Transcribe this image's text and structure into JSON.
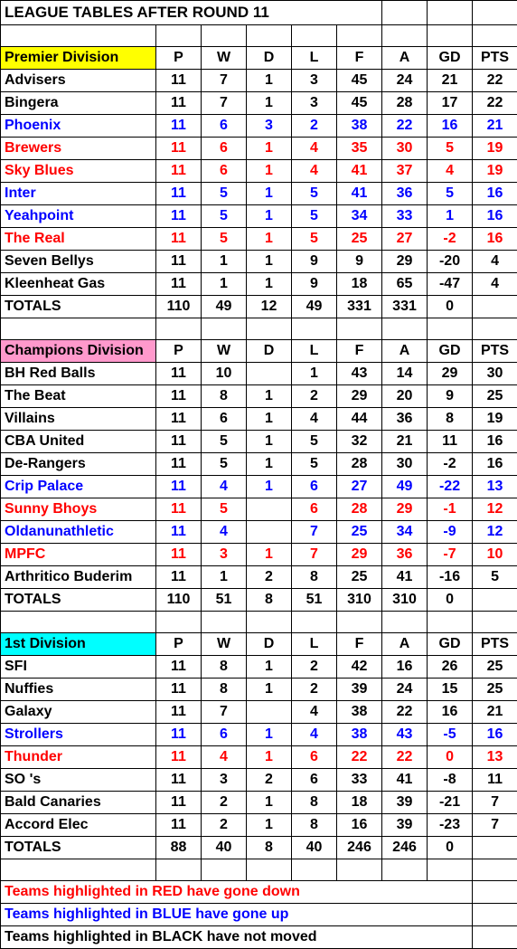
{
  "title": "LEAGUE TABLES AFTER ROUND 11",
  "columns": [
    "P",
    "W",
    "D",
    "L",
    "F",
    "A",
    "GD",
    "PTS"
  ],
  "divisions": [
    {
      "name": "Premier Division",
      "bg": "yellow",
      "rows": [
        {
          "team": "Advisers",
          "color": "c-black",
          "v": [
            "11",
            "7",
            "1",
            "3",
            "45",
            "24",
            "21",
            "22"
          ]
        },
        {
          "team": "Bingera",
          "color": "c-black",
          "v": [
            "11",
            "7",
            "1",
            "3",
            "45",
            "28",
            "17",
            "22"
          ]
        },
        {
          "team": "Phoenix",
          "color": "c-blue",
          "v": [
            "11",
            "6",
            "3",
            "2",
            "38",
            "22",
            "16",
            "21"
          ]
        },
        {
          "team": "Brewers",
          "color": "c-red",
          "v": [
            "11",
            "6",
            "1",
            "4",
            "35",
            "30",
            "5",
            "19"
          ]
        },
        {
          "team": "Sky Blues",
          "color": "c-red",
          "v": [
            "11",
            "6",
            "1",
            "4",
            "41",
            "37",
            "4",
            "19"
          ]
        },
        {
          "team": "Inter",
          "color": "c-blue",
          "v": [
            "11",
            "5",
            "1",
            "5",
            "41",
            "36",
            "5",
            "16"
          ]
        },
        {
          "team": "Yeahpoint",
          "color": "c-blue",
          "v": [
            "11",
            "5",
            "1",
            "5",
            "34",
            "33",
            "1",
            "16"
          ]
        },
        {
          "team": "The Real",
          "color": "c-red",
          "v": [
            "11",
            "5",
            "1",
            "5",
            "25",
            "27",
            "-2",
            "16"
          ]
        },
        {
          "team": "Seven Bellys",
          "color": "c-black",
          "v": [
            "11",
            "1",
            "1",
            "9",
            "9",
            "29",
            "-20",
            "4"
          ]
        },
        {
          "team": "Kleenheat Gas",
          "color": "c-black",
          "v": [
            "11",
            "1",
            "1",
            "9",
            "18",
            "65",
            "-47",
            "4"
          ]
        }
      ],
      "totals": [
        "110",
        "49",
        "12",
        "49",
        "331",
        "331",
        "0",
        ""
      ]
    },
    {
      "name": "Champions Division",
      "bg": "pink",
      "rows": [
        {
          "team": "BH Red Balls",
          "color": "c-black",
          "v": [
            "11",
            "10",
            "",
            "1",
            "43",
            "14",
            "29",
            "30"
          ]
        },
        {
          "team": "The Beat",
          "color": "c-black",
          "v": [
            "11",
            "8",
            "1",
            "2",
            "29",
            "20",
            "9",
            "25"
          ]
        },
        {
          "team": "Villains",
          "color": "c-black",
          "v": [
            "11",
            "6",
            "1",
            "4",
            "44",
            "36",
            "8",
            "19"
          ]
        },
        {
          "team": "CBA United",
          "color": "c-black",
          "v": [
            "11",
            "5",
            "1",
            "5",
            "32",
            "21",
            "11",
            "16"
          ]
        },
        {
          "team": "De-Rangers",
          "color": "c-black",
          "v": [
            "11",
            "5",
            "1",
            "5",
            "28",
            "30",
            "-2",
            "16"
          ]
        },
        {
          "team": "Crip     Palace",
          "color": "c-blue",
          "v": [
            "11",
            "4",
            "1",
            "6",
            "27",
            "49",
            "-22",
            "13"
          ]
        },
        {
          "team": "Sunny Bhoys",
          "color": "c-red",
          "v": [
            "11",
            "5",
            "",
            "6",
            "28",
            "29",
            "-1",
            "12"
          ]
        },
        {
          "team": "Oldanunathletic",
          "color": "c-blue",
          "v": [
            "11",
            "4",
            "",
            "7",
            "25",
            "34",
            "-9",
            "12"
          ]
        },
        {
          "team": "MPFC",
          "color": "c-red",
          "v": [
            "11",
            "3",
            "1",
            "7",
            "29",
            "36",
            "-7",
            "10"
          ]
        },
        {
          "team": "Arthritico Buderim",
          "color": "c-black",
          "v": [
            "11",
            "1",
            "2",
            "8",
            "25",
            "41",
            "-16",
            "5"
          ]
        }
      ],
      "totals": [
        "110",
        "51",
        "8",
        "51",
        "310",
        "310",
        "0",
        ""
      ]
    },
    {
      "name": "1st Division",
      "bg": "cyan",
      "rows": [
        {
          "team": "SFI",
          "color": "c-black",
          "v": [
            "11",
            "8",
            "1",
            "2",
            "42",
            "16",
            "26",
            "25"
          ]
        },
        {
          "team": "Nuffies",
          "color": "c-black",
          "v": [
            "11",
            "8",
            "1",
            "2",
            "39",
            "24",
            "15",
            "25"
          ]
        },
        {
          "team": "Galaxy",
          "color": "c-black",
          "v": [
            "11",
            "7",
            "",
            "4",
            "38",
            "22",
            "16",
            "21"
          ]
        },
        {
          "team": "Strollers",
          "color": "c-blue",
          "v": [
            "11",
            "6",
            "1",
            "4",
            "38",
            "43",
            "-5",
            "16"
          ]
        },
        {
          "team": "Thunder",
          "color": "c-red",
          "v": [
            "11",
            "4",
            "1",
            "6",
            "22",
            "22",
            "0",
            "13"
          ]
        },
        {
          "team": "SO  's",
          "color": "c-black",
          "v": [
            "11",
            "3",
            "2",
            "6",
            "33",
            "41",
            "-8",
            "11"
          ]
        },
        {
          "team": "Bald Canaries",
          "color": "c-black",
          "v": [
            "11",
            "2",
            "1",
            "8",
            "18",
            "39",
            "-21",
            "7"
          ]
        },
        {
          "team": "Accord Elec",
          "color": "c-black",
          "v": [
            "11",
            "2",
            "1",
            "8",
            "16",
            "39",
            "-23",
            "7"
          ]
        }
      ],
      "totals": [
        "88",
        "40",
        "8",
        "40",
        "246",
        "246",
        "0",
        ""
      ]
    }
  ],
  "totals_label": "TOTALS",
  "legend": [
    {
      "text": "Teams highlighted in RED have gone down",
      "color": "c-red"
    },
    {
      "text": "Teams highlighted in BLUE have gone up",
      "color": "c-blue"
    },
    {
      "text": "Teams highlighted in BLACK have not moved",
      "color": "c-black"
    }
  ]
}
